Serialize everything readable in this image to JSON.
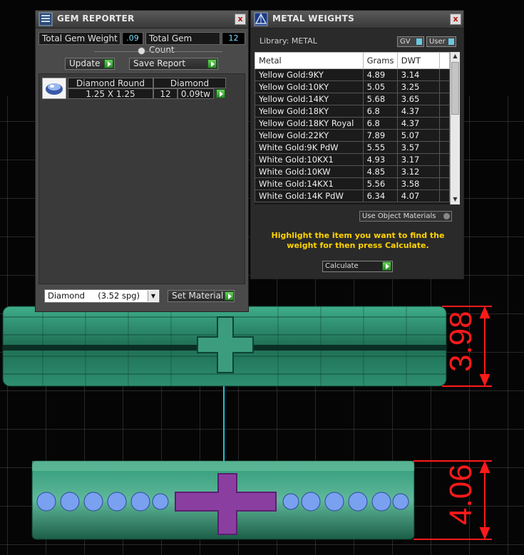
{
  "gem_reporter": {
    "title": "GEM REPORTER",
    "close": "x",
    "total_weight_label": "Total Gem Weight",
    "total_weight_value": ".09",
    "total_count_label": "Total Gem Count",
    "total_count_value": "12",
    "update_label": "Update",
    "save_report_label": "Save Report",
    "gem": {
      "shape": "Diamond Round",
      "material": "Diamond",
      "size": "1.25 X 1.25",
      "count": "12",
      "weight": "0.09tw"
    },
    "material_select": "Diamond     (3.52 spg)",
    "set_material_label": "Set Material"
  },
  "metal_weights": {
    "title": "METAL WEIGHTS",
    "close": "x",
    "library_label": "Library: METAL",
    "gv_label": "GV",
    "user_label": "User",
    "columns": [
      "Metal",
      "Grams",
      "DWT"
    ],
    "rows": [
      {
        "metal": "Yellow Gold:9KY",
        "grams": "4.89",
        "dwt": "3.14"
      },
      {
        "metal": "Yellow Gold:10KY",
        "grams": "5.05",
        "dwt": "3.25"
      },
      {
        "metal": "Yellow Gold:14KY",
        "grams": "5.68",
        "dwt": "3.65"
      },
      {
        "metal": "Yellow Gold:18KY",
        "grams": "6.8",
        "dwt": "4.37"
      },
      {
        "metal": "Yellow Gold:18KY Royal",
        "grams": "6.8",
        "dwt": "4.37"
      },
      {
        "metal": "Yellow Gold:22KY",
        "grams": "7.89",
        "dwt": "5.07"
      },
      {
        "metal": "White Gold:9K PdW",
        "grams": "5.55",
        "dwt": "3.57"
      },
      {
        "metal": "White Gold:10KX1",
        "grams": "4.93",
        "dwt": "3.17"
      },
      {
        "metal": "White Gold:10KW",
        "grams": "4.85",
        "dwt": "3.12"
      },
      {
        "metal": "White Gold:14KX1",
        "grams": "5.56",
        "dwt": "3.58"
      },
      {
        "metal": "White Gold:14K PdW",
        "grams": "6.34",
        "dwt": "4.07"
      }
    ],
    "use_object_materials": "Use Object Materials",
    "instruction": "Highlight the item you want to find the weight for then press Calculate.",
    "calculate_label": "Calculate"
  },
  "viewport": {
    "dim_top": "3.98",
    "dim_bottom": "4.06"
  },
  "colors": {
    "ring_green": "#2f9a78",
    "dimension_red": "#ff1a1a",
    "instruction_yellow": "#ffd400",
    "value_cyan": "#7fe0ff"
  }
}
